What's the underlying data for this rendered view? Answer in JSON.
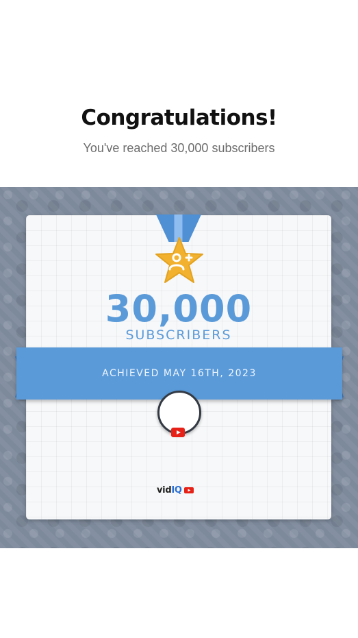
{
  "header": {
    "title": "Congratulations!",
    "subtitle": "You've reached 30,000 subscribers"
  },
  "card": {
    "count": "30,000",
    "count_label": "SUBSCRIBERS",
    "achieved_text": "ACHIEVED MAY 16TH, 2023",
    "medal_icon": "user-plus-icon",
    "brand_name_prefix": "vid",
    "brand_name_suffix": "IQ"
  },
  "colors": {
    "accent_blue": "#5a9ad9",
    "medal_gold": "#f2b230",
    "pattern_background": "#7d8a9c"
  }
}
